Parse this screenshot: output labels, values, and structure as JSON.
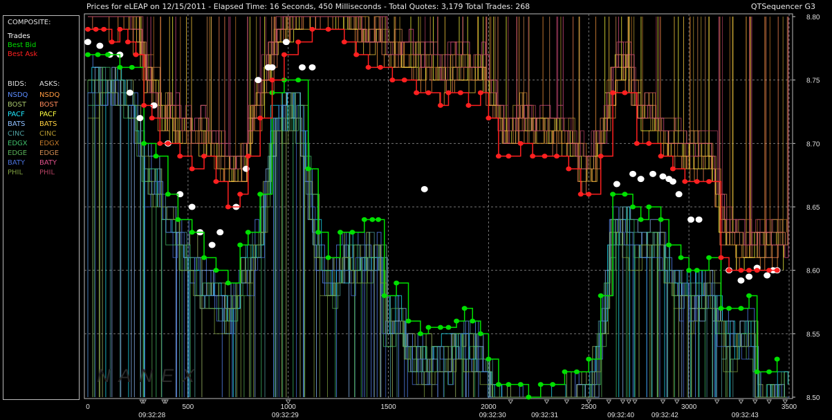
{
  "header": {
    "title": "Prices for  eLEAP  on  12/15/2011  -  Elapsed Time: 16 Seconds, 450 Milliseconds  -  Total Quotes: 3,179  Total Trades: 268",
    "app_name": "QTSequencer G3"
  },
  "legend": {
    "composite_label": "COMPOSITE:",
    "composite_items": [
      {
        "label": "Trades",
        "color": "#ffffff"
      },
      {
        "label": "Best Bid",
        "color": "#00e000"
      },
      {
        "label": "Best Ask",
        "color": "#ff2020"
      }
    ],
    "bids_label": "BIDS:",
    "asks_label": "ASKS:",
    "venues": [
      {
        "bid": "NSDQ",
        "ask": "NSDQ",
        "bid_color": "#5b8cff",
        "ask_color": "#ff9a40"
      },
      {
        "bid": "BOST",
        "ask": "BOST",
        "bid_color": "#a6c46a",
        "ask_color": "#ff8a5a"
      },
      {
        "bid": "PACF",
        "ask": "PACF",
        "bid_color": "#20e8ff",
        "ask_color": "#ffff40"
      },
      {
        "bid": "BATS",
        "ask": "BATS",
        "bid_color": "#8fc0ff",
        "ask_color": "#ffd040"
      },
      {
        "bid": "CINC",
        "ask": "CINC",
        "bid_color": "#4f9fa0",
        "ask_color": "#b89a30"
      },
      {
        "bid": "EDGX",
        "ask": "EDGX",
        "bid_color": "#3fbf6a",
        "ask_color": "#c47a2a"
      },
      {
        "bid": "EDGE",
        "ask": "EDGE",
        "bid_color": "#58b058",
        "ask_color": "#d08a50"
      },
      {
        "bid": "BATY",
        "ask": "BATY",
        "bid_color": "#4a70d8",
        "ask_color": "#e0508a"
      },
      {
        "bid": "PHIL",
        "ask": "PHIL",
        "bid_color": "#7fa040",
        "ask_color": "#b04060"
      }
    ]
  },
  "watermark": "NANEX",
  "chart_data": {
    "type": "line",
    "xlim": [
      0,
      3500
    ],
    "ylim": [
      8.5,
      8.8
    ],
    "x_ticks": [
      0,
      500,
      1000,
      1500,
      2000,
      2500,
      3000,
      3500
    ],
    "y_ticks": [
      8.5,
      8.55,
      8.6,
      8.65,
      8.7,
      8.75,
      8.8
    ],
    "y_tick_labels": [
      "8.50",
      "8.55",
      "8.60",
      "8.65",
      "8.70",
      "8.75",
      "8.80"
    ],
    "time_labels": [
      {
        "x": 320,
        "label": "09:32:28"
      },
      {
        "x": 985,
        "label": "09:32:29"
      },
      {
        "x": 2020,
        "label": "09:32:30"
      },
      {
        "x": 2280,
        "label": "09:32:31"
      },
      {
        "x": 2660,
        "label": "09:32:40"
      },
      {
        "x": 2880,
        "label": "09:32:42"
      },
      {
        "x": 3280,
        "label": "09:32:43"
      }
    ],
    "time_marker_x": [
      270,
      280,
      380,
      390,
      1000,
      2110,
      2290,
      2390,
      2500,
      2600,
      2670,
      2700,
      2730,
      2870,
      2940,
      3140,
      3260,
      3330,
      3400,
      3480
    ],
    "grid": true,
    "series": [
      {
        "name": "Trades",
        "color": "#ffffff",
        "x": [
          0,
          60,
          110,
          160,
          210,
          260,
          330,
          400,
          460,
          520,
          560,
          620,
          660,
          740,
          790,
          850,
          900,
          920,
          990,
          1070,
          1120,
          1680,
          2640,
          2720,
          2760,
          2820,
          2870,
          2900,
          2920,
          2950,
          3010,
          3050,
          3200,
          3260,
          3300,
          3340,
          3390,
          3420,
          3440
        ],
        "y": [
          8.78,
          8.777,
          8.77,
          8.77,
          8.74,
          8.72,
          8.73,
          8.7,
          8.66,
          8.65,
          8.63,
          8.62,
          8.63,
          8.65,
          8.68,
          8.75,
          8.76,
          8.76,
          8.78,
          8.76,
          8.76,
          8.664,
          8.668,
          8.676,
          8.672,
          8.676,
          8.674,
          8.672,
          8.67,
          8.66,
          8.64,
          8.64,
          8.6,
          8.592,
          8.595,
          8.602,
          8.596,
          8.6,
          8.6
        ]
      },
      {
        "name": "Best Bid",
        "color": "#00e000",
        "x": [
          0,
          50,
          100,
          160,
          220,
          280,
          340,
          400,
          450,
          520,
          580,
          640,
          700,
          760,
          800,
          860,
          920,
          980,
          1050,
          1100,
          1150,
          1200,
          1260,
          1320,
          1380,
          1420,
          1450,
          1480,
          1540,
          1600,
          1660,
          1700,
          1760,
          1800,
          1840,
          1880,
          1920,
          1960,
          2000,
          2050,
          2100,
          2160,
          2200,
          2260,
          2320,
          2380,
          2440,
          2500,
          2560,
          2620,
          2680,
          2720,
          2760,
          2800,
          2860,
          2900,
          2960,
          3000,
          3040,
          3100,
          3160,
          3200,
          3260,
          3300,
          3340,
          3400,
          3440
        ],
        "y": [
          8.77,
          8.77,
          8.77,
          8.76,
          8.76,
          8.7,
          8.69,
          8.66,
          8.64,
          8.63,
          8.61,
          8.6,
          8.59,
          8.62,
          8.63,
          8.66,
          8.74,
          8.75,
          8.75,
          8.68,
          8.63,
          8.61,
          8.63,
          8.63,
          8.64,
          8.64,
          8.64,
          8.58,
          8.59,
          8.56,
          8.55,
          8.555,
          8.555,
          8.555,
          8.56,
          8.57,
          8.56,
          8.55,
          8.53,
          8.51,
          8.51,
          8.51,
          8.5,
          8.51,
          8.51,
          8.52,
          8.52,
          8.53,
          8.58,
          8.66,
          8.66,
          8.65,
          8.64,
          8.65,
          8.64,
          8.62,
          8.61,
          8.6,
          8.6,
          8.61,
          8.57,
          8.57,
          8.57,
          8.58,
          8.52,
          8.52,
          8.53
        ]
      },
      {
        "name": "Best Ask",
        "color": "#ff2020",
        "x": [
          0,
          40,
          80,
          120,
          160,
          200,
          240,
          280,
          320,
          360,
          400,
          460,
          520,
          580,
          640,
          700,
          760,
          800,
          860,
          920,
          980,
          1050,
          1120,
          1200,
          1280,
          1340,
          1400,
          1460,
          1520,
          1580,
          1640,
          1700,
          1760,
          1800,
          1860,
          1900,
          1960,
          2000,
          2050,
          2100,
          2160,
          2220,
          2280,
          2340,
          2400,
          2460,
          2500,
          2560,
          2620,
          2680,
          2740,
          2800,
          2860,
          2920,
          2980,
          3040,
          3100,
          3160,
          3200,
          3260,
          3300,
          3340,
          3400,
          3440
        ],
        "y": [
          8.79,
          8.79,
          8.79,
          8.78,
          8.79,
          8.78,
          8.77,
          8.73,
          8.72,
          8.7,
          8.7,
          8.69,
          8.68,
          8.69,
          8.67,
          8.65,
          8.66,
          8.69,
          8.72,
          8.75,
          8.77,
          8.78,
          8.79,
          8.79,
          8.78,
          8.77,
          8.76,
          8.76,
          8.75,
          8.75,
          8.74,
          8.74,
          8.73,
          8.74,
          8.74,
          8.73,
          8.74,
          8.72,
          8.69,
          8.69,
          8.7,
          8.69,
          8.69,
          8.69,
          8.68,
          8.66,
          8.66,
          8.69,
          8.74,
          8.74,
          8.7,
          8.7,
          8.69,
          8.68,
          8.67,
          8.67,
          8.67,
          8.61,
          8.6,
          8.6,
          8.6,
          8.6,
          8.6,
          8.6
        ]
      }
    ]
  }
}
